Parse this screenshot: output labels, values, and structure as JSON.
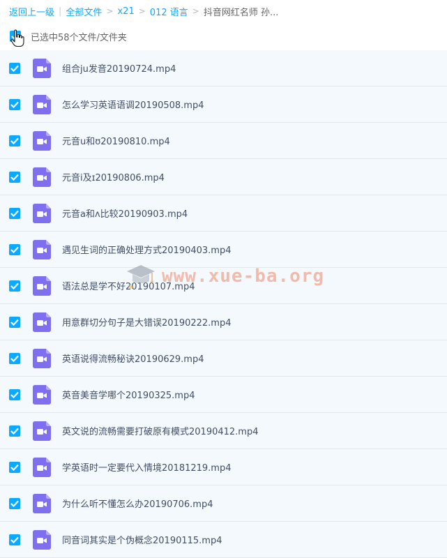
{
  "breadcrumb": {
    "back": "返回上一级",
    "all_files": "全部文件",
    "segments": [
      "x21",
      "012 语言"
    ],
    "current": "抖音网红名师 孙..."
  },
  "selection": {
    "text": "已选中58个文件/文件夹",
    "checked": true
  },
  "colors": {
    "accent": "#09aaff",
    "video_icon": "#7e6ef0",
    "row_selected_bg": "#f4f9fd"
  },
  "files": [
    {
      "name": "组合ju发音20190724.mp4",
      "icon": "video-file-icon",
      "checked": true
    },
    {
      "name": "怎么学习英语语调20190508.mp4",
      "icon": "video-file-icon",
      "checked": true
    },
    {
      "name": "元音u和ʊ20190810.mp4",
      "icon": "video-file-icon",
      "checked": true
    },
    {
      "name": "元音i及ɪ20190806.mp4",
      "icon": "video-file-icon",
      "checked": true
    },
    {
      "name": "元音a和ʌ比较20190903.mp4",
      "icon": "video-file-icon",
      "checked": true
    },
    {
      "name": "遇见生词的正确处理方式20190403.mp4",
      "icon": "video-file-icon",
      "checked": true
    },
    {
      "name": "语法总是学不好20190107.mp4",
      "icon": "video-file-icon",
      "checked": true
    },
    {
      "name": "用意群切分句子是大错误20190222.mp4",
      "icon": "video-file-icon",
      "checked": true
    },
    {
      "name": "英语说得流畅秘诀20190629.mp4",
      "icon": "video-file-icon",
      "checked": true
    },
    {
      "name": "英音美音学哪个20190325.mp4",
      "icon": "video-file-icon",
      "checked": true
    },
    {
      "name": "英文说的流畅需要打破原有模式20190412.mp4",
      "icon": "video-file-icon",
      "checked": true
    },
    {
      "name": "学英语时一定要代入情境20181219.mp4",
      "icon": "video-file-icon",
      "checked": true
    },
    {
      "name": "为什么听不懂怎么办20190706.mp4",
      "icon": "video-file-icon",
      "checked": true
    },
    {
      "name": "同音词其实是个伪概念20190115.mp4",
      "icon": "video-file-icon",
      "checked": true
    }
  ],
  "watermark": {
    "text": "www.xue-ba.org"
  }
}
